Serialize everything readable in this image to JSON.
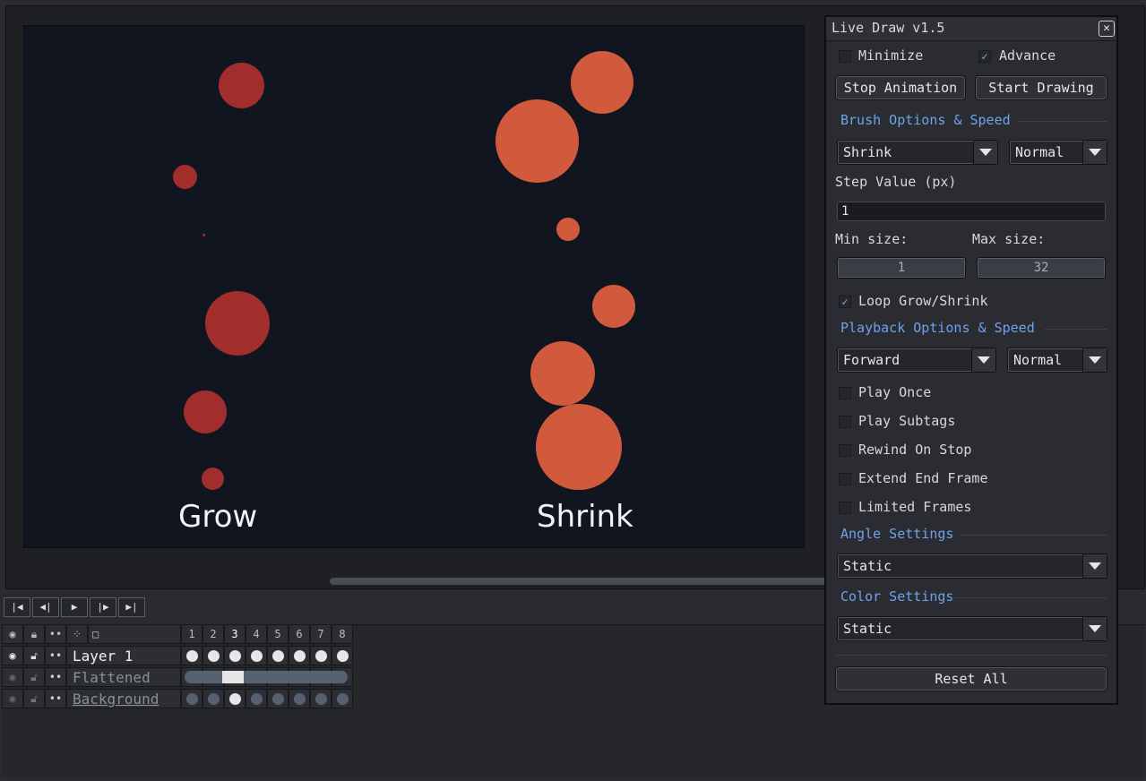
{
  "canvas": {
    "grow_caption": "Grow",
    "shrink_caption": "Shrink",
    "grow_color": "#a22d2d",
    "shrink_color": "#d25a3c",
    "background_color": "#111520"
  },
  "playback": {
    "first_frame_icon": "skip-first-icon",
    "prev_frame_icon": "prev-frame-icon",
    "play_icon": "play-icon",
    "next_frame_icon": "next-frame-icon",
    "last_frame_icon": "skip-last-icon"
  },
  "timeline": {
    "frames": [
      "1",
      "2",
      "3",
      "4",
      "5",
      "6",
      "7",
      "8"
    ],
    "current_frame": "3",
    "layers": [
      {
        "name": "Layer 1",
        "visible": true
      },
      {
        "name": "Flattened",
        "visible": false
      },
      {
        "name": "Background",
        "visible": false
      }
    ]
  },
  "dialog": {
    "title": "Live Draw v1.5",
    "close_icon": "close-icon",
    "minimize_label": "Minimize",
    "minimize_checked": false,
    "advance_label": "Advance",
    "advance_checked": true,
    "stop_animation_label": "Stop Animation",
    "start_drawing_label": "Start Drawing",
    "brush_section": "Brush Options & Speed",
    "brush_mode": "Shrink",
    "brush_speed": "Normal",
    "step_value_label": "Step Value (px)",
    "step_value": "1",
    "min_size_label": "Min size:",
    "max_size_label": "Max size:",
    "min_size": "1",
    "max_size": "32",
    "loop_label": "Loop Grow/Shrink",
    "loop_checked": true,
    "playback_section": "Playback Options & Speed",
    "playback_direction": "Forward",
    "playback_speed": "Normal",
    "play_once_label": "Play Once",
    "play_subtags_label": "Play Subtags",
    "rewind_label": "Rewind On Stop",
    "extend_label": "Extend End Frame",
    "limited_label": "Limited Frames",
    "angle_section": "Angle Settings",
    "angle_value": "Static",
    "color_section": "Color Settings",
    "color_value": "Static",
    "reset_label": "Reset All"
  }
}
